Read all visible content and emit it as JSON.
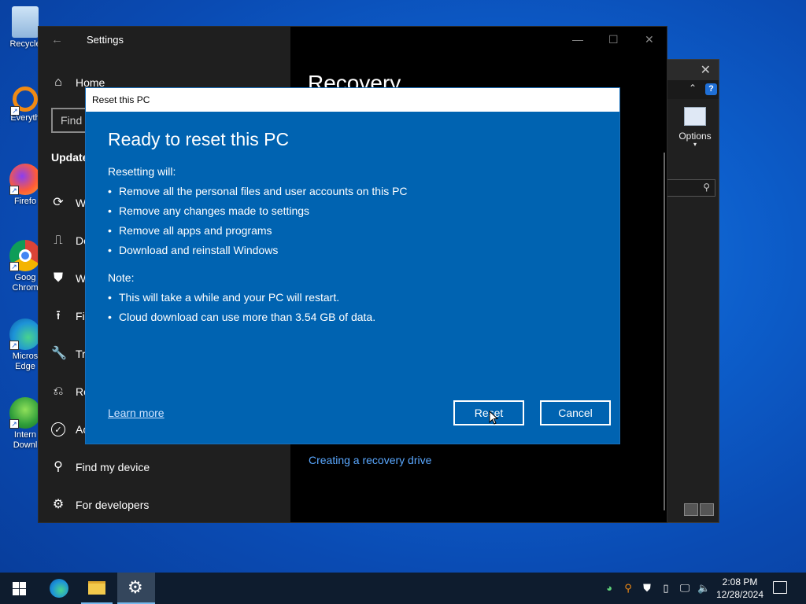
{
  "desktop": {
    "icons": [
      {
        "label": "Recycle",
        "icon": "recycle-bin-icon"
      },
      {
        "label": "Everyth",
        "icon": "everything-search-icon"
      },
      {
        "label": "Firefo",
        "icon": "firefox-icon"
      },
      {
        "label": "Goog Chrom",
        "icon": "chrome-icon"
      },
      {
        "label": "Micros Edge",
        "icon": "edge-icon"
      },
      {
        "label": "Intern Downl",
        "icon": "internet-download-manager-icon"
      }
    ]
  },
  "explorer": {
    "options_label": "Options",
    "close_glyph": "✕",
    "up_glyph": "⌃",
    "help_glyph": "?"
  },
  "settings": {
    "app_title": "Settings",
    "back_glyph": "←",
    "minimize_glyph": "—",
    "maximize_glyph": "☐",
    "close_glyph": "✕",
    "search_placeholder": "Find",
    "section": "Update",
    "page_title": "Recovery",
    "recovery_link": "Creating a recovery drive",
    "nav": [
      {
        "label": "Home",
        "icon": "home-icon",
        "glyph": "⌂"
      },
      {
        "label": "W",
        "icon": "windows-update-icon",
        "glyph": "⟳"
      },
      {
        "label": "De",
        "icon": "delivery-optimization-icon",
        "glyph": "⎍"
      },
      {
        "label": "W",
        "icon": "windows-security-icon",
        "glyph": "⛊"
      },
      {
        "label": "Fil",
        "icon": "file-backup-icon",
        "glyph": "⭱"
      },
      {
        "label": "Tr",
        "icon": "troubleshoot-icon",
        "glyph": "🔧"
      },
      {
        "label": "Re",
        "icon": "recovery-icon",
        "glyph": "⎌"
      },
      {
        "label": "Ac",
        "icon": "activation-icon",
        "glyph": "✓"
      },
      {
        "label": "Find my device",
        "icon": "find-my-device-icon",
        "glyph": "⚲"
      },
      {
        "label": "For developers",
        "icon": "for-developers-icon",
        "glyph": "⚙"
      }
    ]
  },
  "dialog": {
    "window_title": "Reset this PC",
    "heading": "Ready to reset this PC",
    "resetting_label": "Resetting will:",
    "resetting_items": [
      "Remove all the personal files and user accounts on this PC",
      "Remove any changes made to settings",
      "Remove all apps and programs",
      "Download and reinstall Windows"
    ],
    "note_label": "Note:",
    "note_items": [
      "This will take a while and your PC will restart.",
      "Cloud download can use more than 3.54 GB of data."
    ],
    "learn_more": "Learn more",
    "reset_button": "Reset",
    "cancel_button": "Cancel"
  },
  "taskbar": {
    "time": "2:08 PM",
    "date": "12/28/2024"
  },
  "colors": {
    "dialog_blue": "#0063b1",
    "link_blue": "#5aa8ff",
    "taskbar": "#0e1c2e"
  }
}
